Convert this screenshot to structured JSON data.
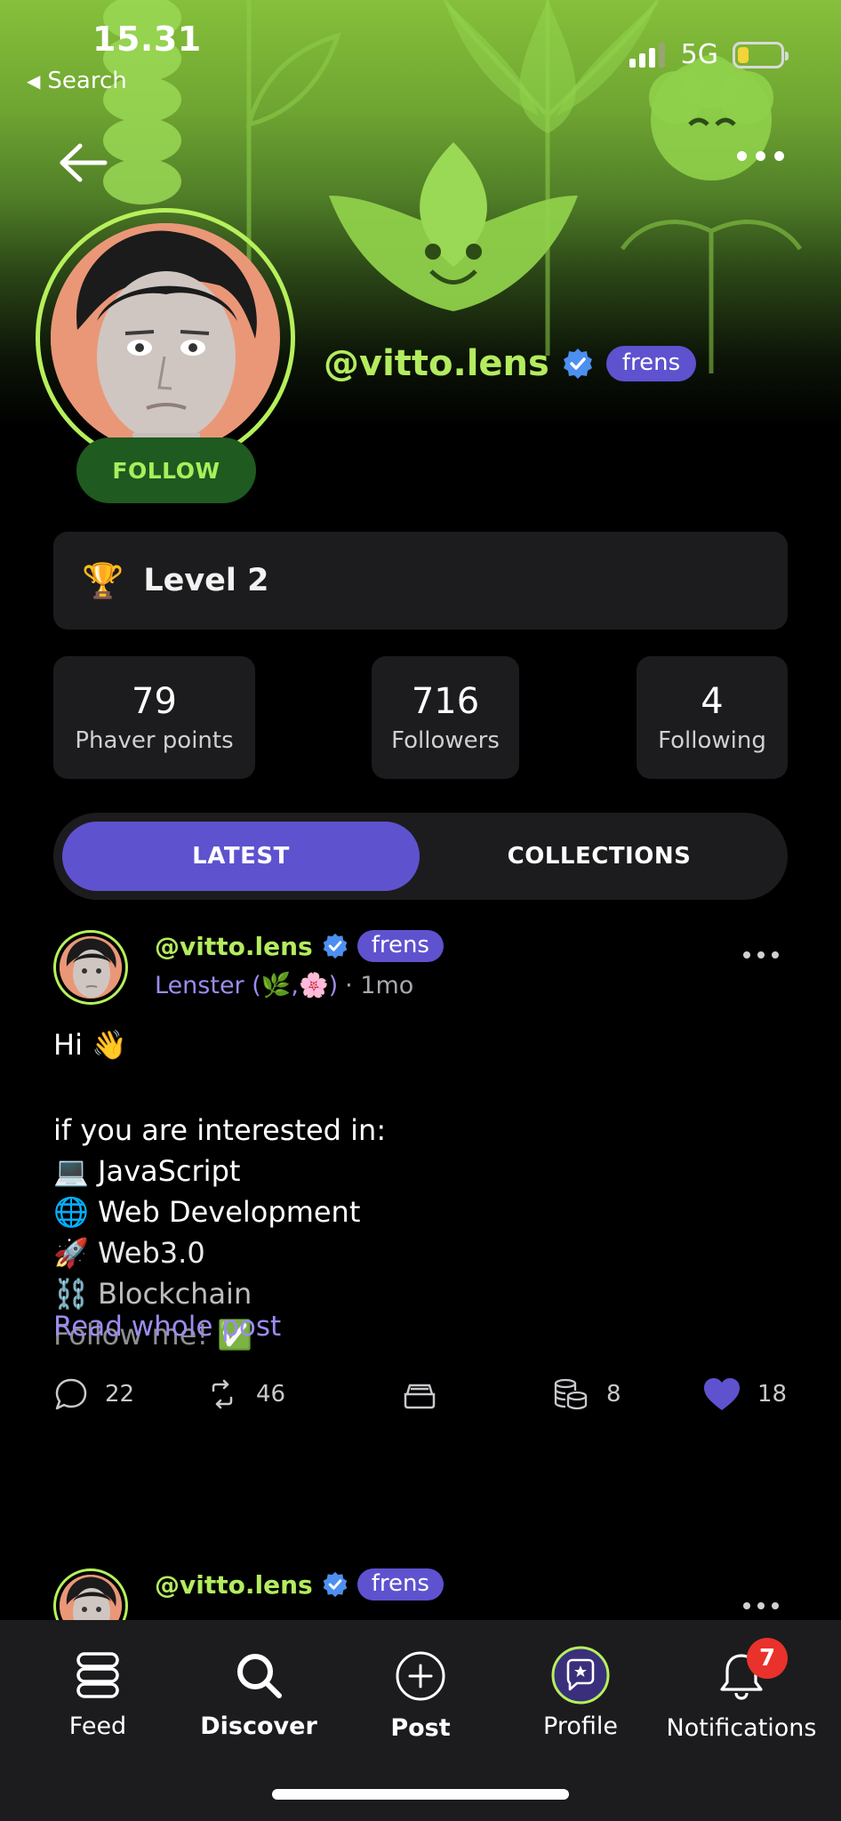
{
  "status_bar": {
    "time": "15.31",
    "back_label": "Search",
    "network": "5G",
    "battery_level": 0.25,
    "battery_color": "#f3d43a"
  },
  "profile": {
    "handle": "@vitto.lens",
    "badge": "frens",
    "follow_label": "FOLLOW",
    "level": "Level 2",
    "accent_green": "#b3ec5f",
    "accent_purple": "#5e52cf"
  },
  "stats": [
    {
      "value": "79",
      "label": "Phaver points"
    },
    {
      "value": "716",
      "label": "Followers"
    },
    {
      "value": "4",
      "label": "Following"
    }
  ],
  "tabs": {
    "latest": "LATEST",
    "collections": "COLLECTIONS",
    "active": "LATEST"
  },
  "posts": [
    {
      "handle": "@vitto.lens",
      "badge": "frens",
      "app": "Lenster (🌿,🌸)",
      "time": "· 1mo",
      "lines": [
        "Hi 👋",
        "if you are interested in:",
        "💻 JavaScript",
        "🌐 Web Development",
        "🚀 Web3.0",
        "⛓️ Blockchain",
        "Follow me!  ✅"
      ],
      "read_more": "Read whole post",
      "comments": "22",
      "mirrors": "46",
      "collects": "8",
      "likes": "18"
    },
    {
      "handle": "@vitto.lens",
      "badge": "frens"
    }
  ],
  "bottom_nav": {
    "feed": "Feed",
    "discover": "Discover",
    "post": "Post",
    "profile": "Profile",
    "notifications": "Notifications",
    "notification_count": "7"
  }
}
